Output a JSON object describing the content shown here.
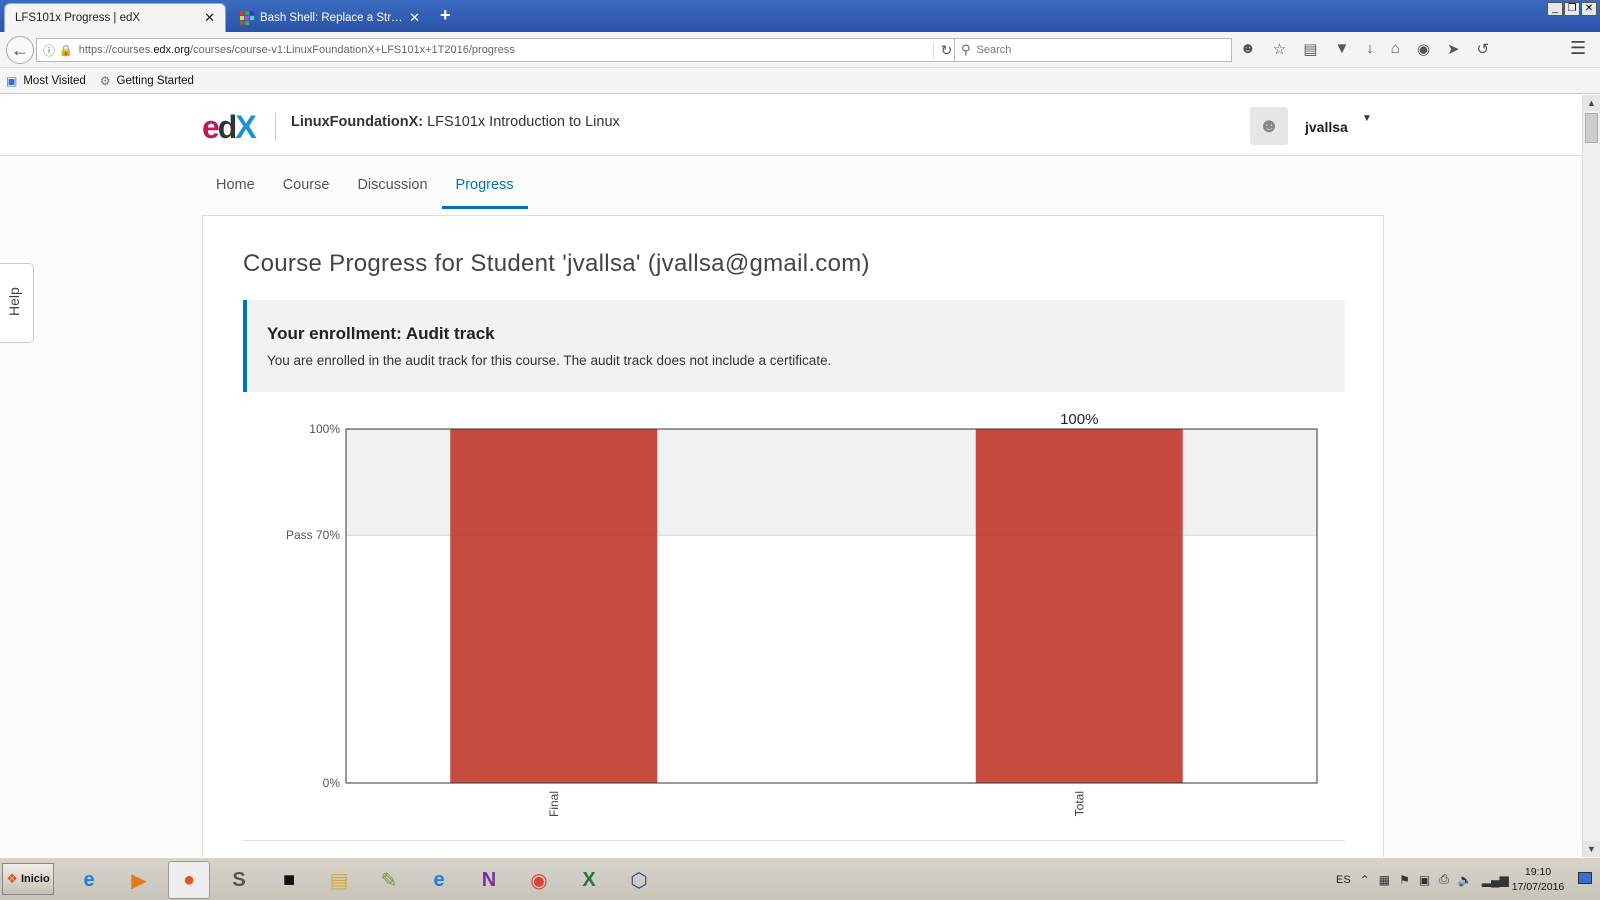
{
  "browser": {
    "tabs": [
      {
        "title": "LFS101x Progress | edX",
        "close": "✕"
      },
      {
        "title": "Bash Shell: Replace a String ...",
        "close": "✕"
      }
    ],
    "new_tab": "+",
    "window_controls": [
      "_",
      "❐",
      "✕"
    ],
    "url_prefix": "https://courses.",
    "url_domain": "edx.org",
    "url_path": "/courses/course-v1:LinuxFoundationX+LFS101x+1T2016/progress",
    "search_placeholder": "Search",
    "bookmarks": [
      "Most Visited",
      "Getting Started"
    ]
  },
  "edx": {
    "logo": {
      "e": "e",
      "d": "d",
      "x": "X"
    },
    "org": "LinuxFoundationX:",
    "course": " LFS101x Introduction to Linux",
    "username": "jvallsa",
    "nav": [
      {
        "label": "Home",
        "active": false
      },
      {
        "label": "Course",
        "active": false
      },
      {
        "label": "Discussion",
        "active": false
      },
      {
        "label": "Progress",
        "active": true
      }
    ],
    "help": "Help",
    "heading": "Course Progress for Student 'jvallsa' (jvallsa@gmail.com)",
    "enrollment": {
      "title": "Your enrollment: Audit track",
      "text": "You are enrolled in the audit track for this course. The audit track does not include a certificate."
    }
  },
  "chart_data": {
    "type": "bar",
    "categories": [
      "Final",
      "Total"
    ],
    "values": [
      100,
      100
    ],
    "ylim": [
      0,
      100
    ],
    "yticks": [
      {
        "value": 100,
        "label": "100%"
      },
      {
        "value": 70,
        "label": "Pass 70%"
      },
      {
        "value": 0,
        "label": "0%"
      }
    ],
    "pass_threshold": 70,
    "data_labels": [
      "",
      "100%"
    ],
    "bar_color": "#c0392b",
    "pass_band_color": "#f1f1f1"
  },
  "taskbar": {
    "start_label": "Inicio",
    "language": "ES",
    "time": "19:10",
    "date": "17/07/2016"
  }
}
